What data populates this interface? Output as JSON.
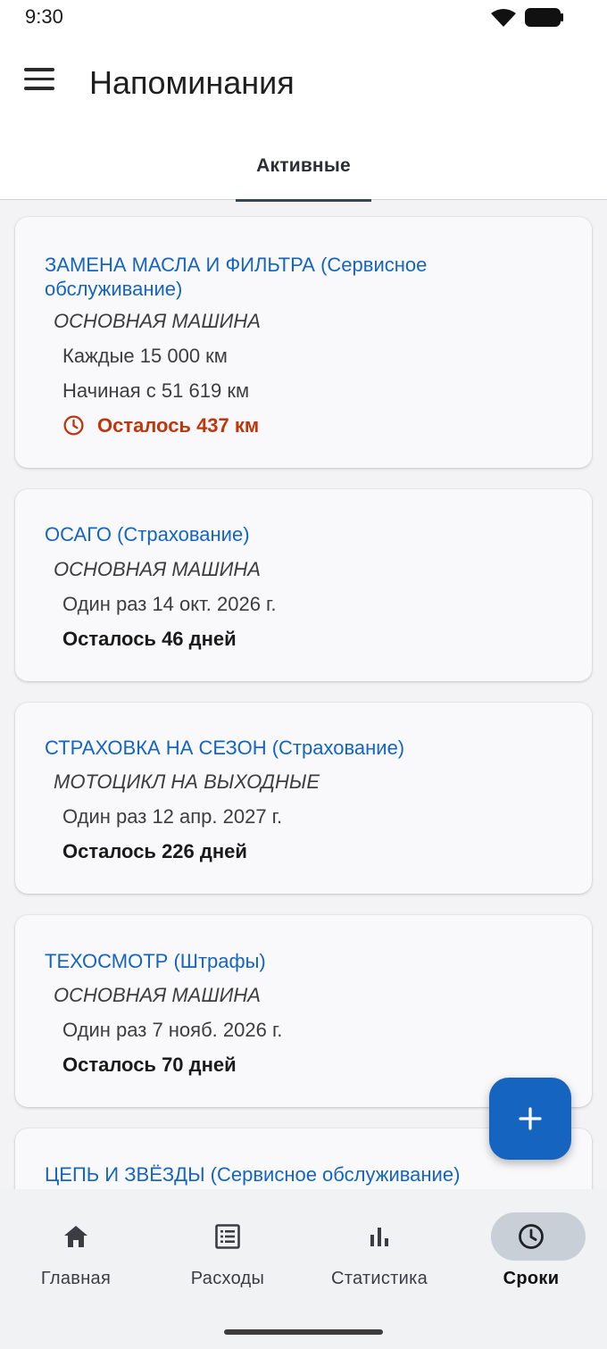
{
  "status_bar": {
    "time": "9:30"
  },
  "app_bar": {
    "title": "Напоминания"
  },
  "tabs": [
    {
      "label": "Активные",
      "active": true
    }
  ],
  "reminders": [
    {
      "title": "ЗАМЕНА МАСЛА И ФИЛЬТРА (Сервисное обслуживание)",
      "vehicle": "ОСНОВНАЯ МАШИНА",
      "lines": [
        "Каждые 15 000 км",
        "Начиная с 51 619 км"
      ],
      "remaining": "Осталось 437 км",
      "alert": true
    },
    {
      "title": "ОСАГО (Страхование)",
      "vehicle": "ОСНОВНАЯ МАШИНА",
      "lines": [
        "Один раз 14 окт. 2026 г."
      ],
      "remaining": "Осталось 46 дней",
      "alert": false
    },
    {
      "title": "СТРАХОВКА НА СЕЗОН (Страхование)",
      "vehicle": "МОТОЦИКЛ НА ВЫХОДНЫЕ",
      "lines": [
        "Один раз 12 апр. 2027 г."
      ],
      "remaining": "Осталось 226 дней",
      "alert": false
    },
    {
      "title": "ТЕХОСМОТР (Штрафы)",
      "vehicle": "ОСНОВНАЯ МАШИНА",
      "lines": [
        "Один раз 7 нояб. 2026 г."
      ],
      "remaining": "Осталось 70 дней",
      "alert": false
    },
    {
      "title": "ЦЕПЬ И ЗВЁЗДЫ (Сервисное обслуживание)"
    }
  ],
  "fab": {
    "icon": "plus-icon"
  },
  "bottom_nav": [
    {
      "label": "Главная",
      "icon": "home-icon",
      "active": false
    },
    {
      "label": "Расходы",
      "icon": "list-icon",
      "active": false
    },
    {
      "label": "Статистика",
      "icon": "bar-chart-icon",
      "active": false
    },
    {
      "label": "Сроки",
      "icon": "clock-icon",
      "active": true
    }
  ],
  "colors": {
    "accent": "#1565c0",
    "alert": "#bf360c",
    "background": "#f3f3f5",
    "card": "#f9f9fb"
  }
}
